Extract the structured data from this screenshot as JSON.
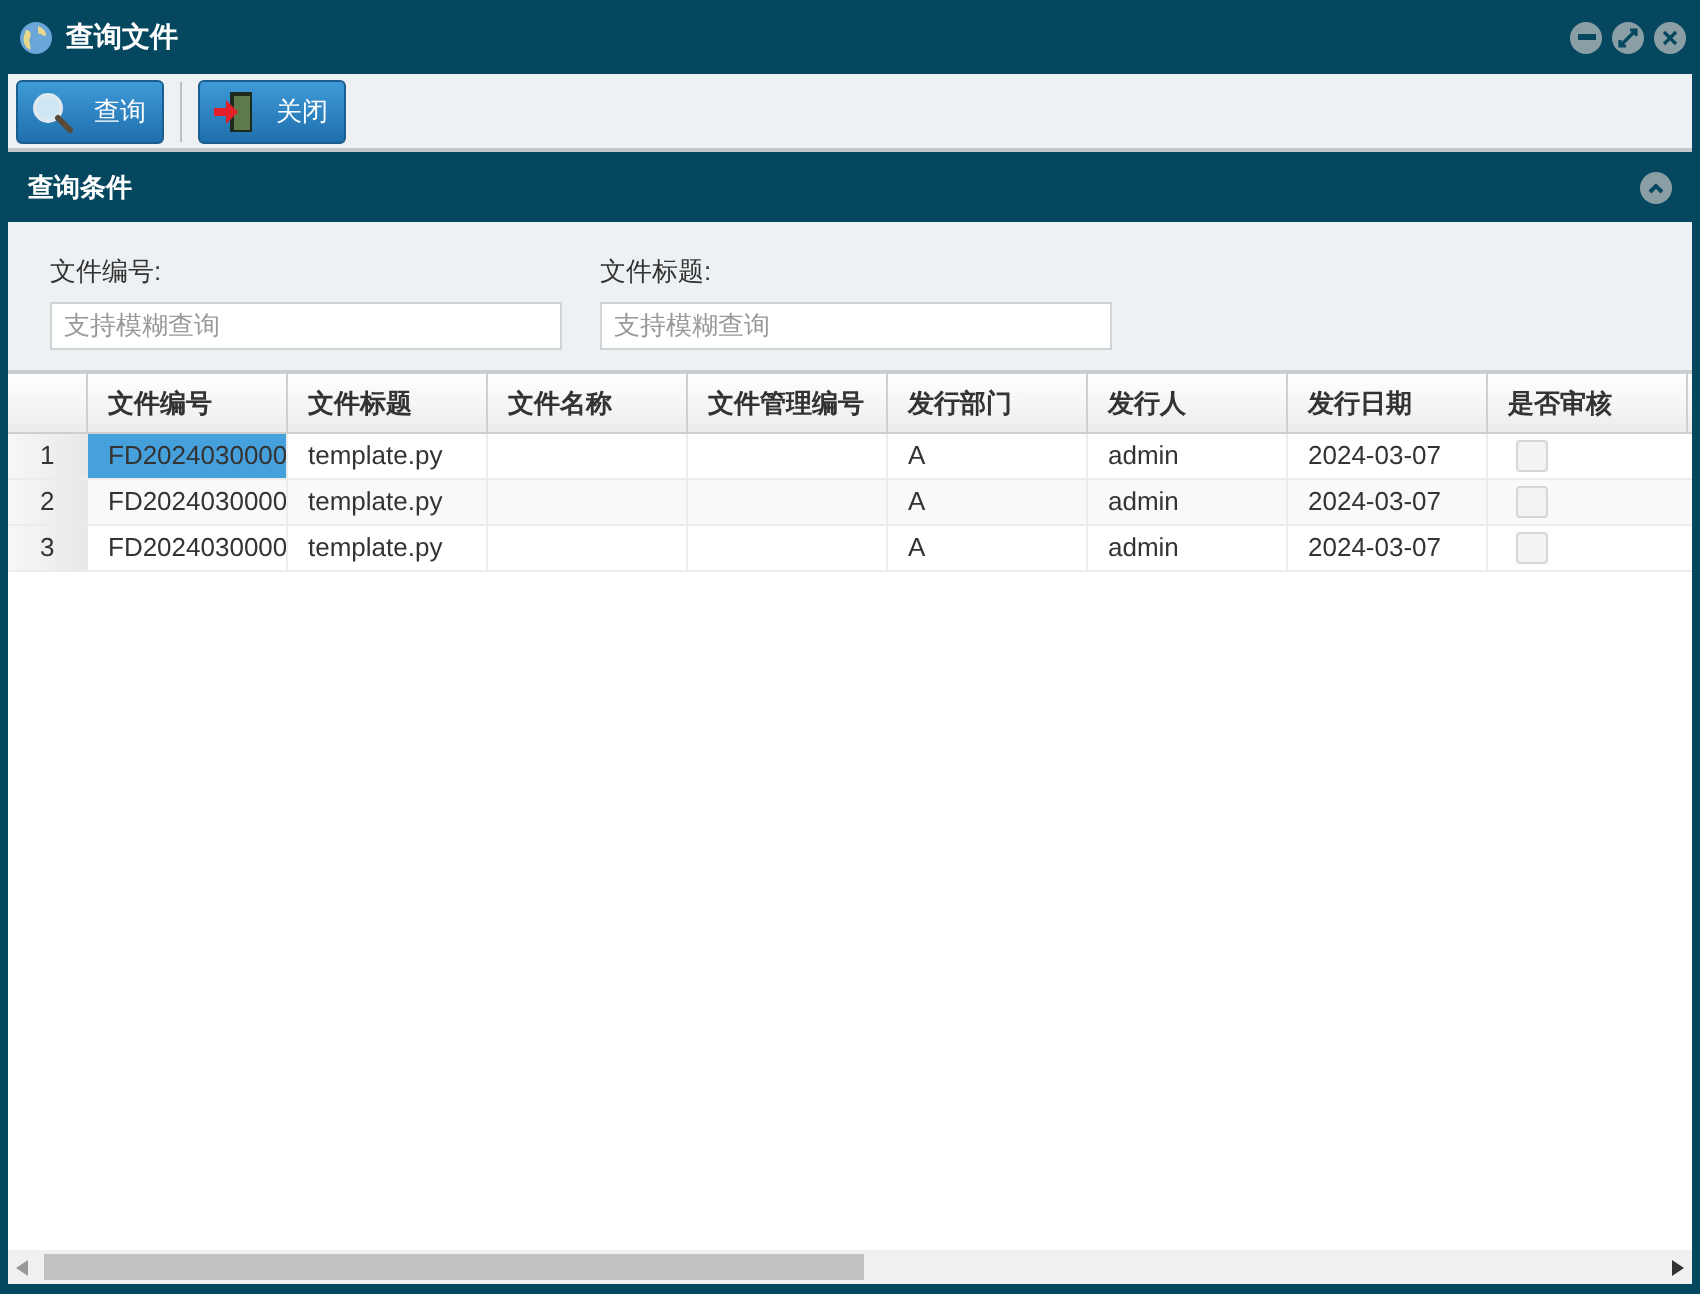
{
  "window": {
    "title": "查询文件"
  },
  "toolbar": [
    {
      "label": "查询",
      "kind": "search"
    },
    {
      "label": "关闭",
      "kind": "exit"
    }
  ],
  "filter_panel": {
    "title": "查询条件",
    "expanded": true,
    "fields": [
      {
        "label": "文件编号:",
        "placeholder": "支持模糊查询"
      },
      {
        "label": "文件标题:",
        "placeholder": "支持模糊查询"
      }
    ]
  },
  "table": {
    "columns": [
      "文件编号",
      "文件标题",
      "文件名称",
      "文件管理编号",
      "发行部门",
      "发行人",
      "发行日期",
      "是否审核"
    ],
    "rows": [
      {
        "index": "1",
        "selected": true,
        "cells": [
          "FD2024030000",
          "template.py",
          "",
          "",
          "A",
          "admin",
          "2024-03-07"
        ],
        "checked": false
      },
      {
        "index": "2",
        "selected": false,
        "cells": [
          "FD2024030000",
          "template.py",
          "",
          "",
          "A",
          "admin",
          "2024-03-07"
        ],
        "checked": false
      },
      {
        "index": "3",
        "selected": false,
        "cells": [
          "FD2024030000",
          "template.py",
          "",
          "",
          "A",
          "admin",
          "2024-03-07"
        ],
        "checked": false
      }
    ]
  }
}
